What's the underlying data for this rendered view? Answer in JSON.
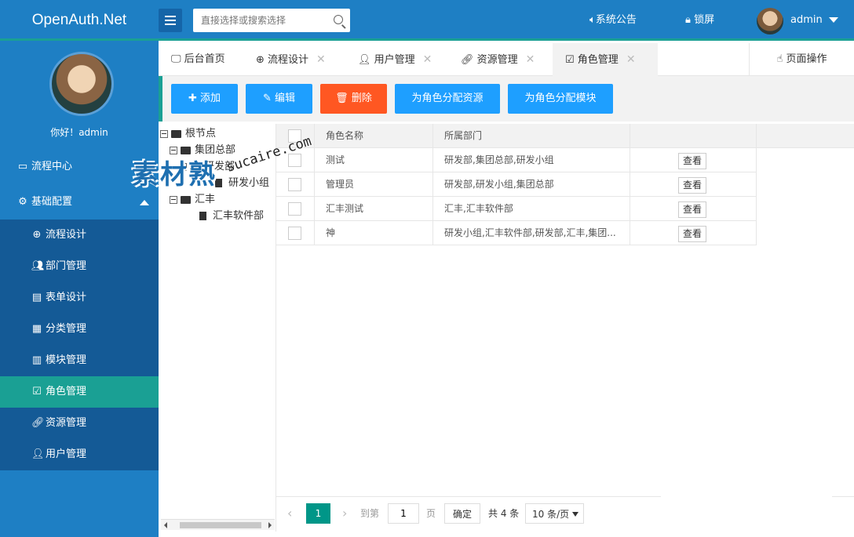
{
  "header": {
    "logo": "OpenAuth.Net",
    "search_placeholder": "直接选择或搜索选择",
    "notice": "系统公告",
    "lock": "锁屏",
    "user": "admin"
  },
  "sidebar": {
    "hello": "你好！admin",
    "items": [
      {
        "label": "流程中心",
        "icon": "window-icon"
      },
      {
        "label": "基础配置",
        "icon": "gear-icon"
      }
    ],
    "sub_items": [
      {
        "label": "流程设计",
        "icon": "flow-icon"
      },
      {
        "label": "部门管理",
        "icon": "users-icon"
      },
      {
        "label": "表单设计",
        "icon": "form-icon"
      },
      {
        "label": "分类管理",
        "icon": "category-icon"
      },
      {
        "label": "模块管理",
        "icon": "module-icon"
      },
      {
        "label": "角色管理",
        "icon": "checkbox-icon"
      },
      {
        "label": "资源管理",
        "icon": "link-icon"
      },
      {
        "label": "用户管理",
        "icon": "user-icon"
      }
    ],
    "active": "角色管理"
  },
  "tabs": [
    {
      "label": "后台首页",
      "icon": "monitor-icon"
    },
    {
      "label": "流程设计",
      "icon": "flow-icon"
    },
    {
      "label": "用户管理",
      "icon": "user-icon"
    },
    {
      "label": "资源管理",
      "icon": "link-icon"
    },
    {
      "label": "角色管理",
      "icon": "checkbox-icon"
    }
  ],
  "page_ops": "页面操作",
  "toolbar": {
    "add": "添加",
    "edit": "编辑",
    "delete": "删除",
    "assign_resource": "为角色分配资源",
    "assign_module": "为角色分配模块"
  },
  "tree": {
    "root": "根节点",
    "nodes": [
      "集团总部",
      "研发部",
      "研发小组",
      "汇丰",
      "汇丰软件部"
    ]
  },
  "table": {
    "headers": [
      "角色名称",
      "所属部门"
    ],
    "rows": [
      {
        "name": "测试",
        "dept": "研发部,集团总部,研发小组",
        "action": "查看"
      },
      {
        "name": "管理员",
        "dept": "研发部,研发小组,集团总部",
        "action": "查看"
      },
      {
        "name": "汇丰测试",
        "dept": "汇丰,汇丰软件部",
        "action": "查看"
      },
      {
        "name": "神",
        "dept": "研发小组,汇丰软件部,研发部,汇丰,集团...",
        "action": "查看"
      }
    ]
  },
  "pager": {
    "prev": "‹",
    "current": "1",
    "next": "›",
    "goto": "到第",
    "page_value": "1",
    "page_unit": "页",
    "confirm": "确定",
    "total": "共 4 条",
    "page_size": "10 条/页"
  },
  "watermark": {
    "cn": "素材熟",
    "en": "sucaire.com"
  }
}
